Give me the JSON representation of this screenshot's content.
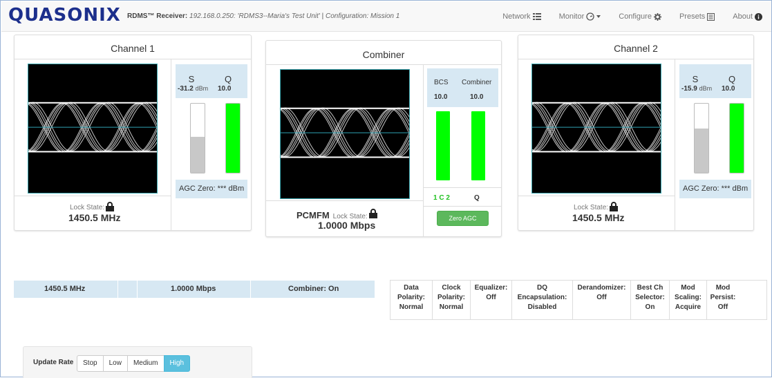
{
  "brand": "QUASONIX",
  "header": {
    "product": "RDMS™ Receiver:",
    "unit": "192.168.0.250: 'RDMS3--Maria's Test Unit'",
    "separator": "|",
    "config": "Configuration: Mission 1"
  },
  "nav": [
    {
      "label": "Network",
      "icon": "list-icon"
    },
    {
      "label": "Monitor",
      "icon": "gauge-icon"
    },
    {
      "label": "Configure",
      "icon": "gear-icon"
    },
    {
      "label": "Presets",
      "icon": "preset-list-icon"
    },
    {
      "label": "About",
      "icon": "info-icon"
    }
  ],
  "channel1": {
    "title": "Channel 1",
    "s_label": "S",
    "q_label": "Q",
    "s_value": "-31.2",
    "s_unit": "dBm",
    "q_value": "10.0",
    "s_level": 0.52,
    "q_level": 1.0,
    "agc": "AGC Zero: *** dBm",
    "lock_label": "Lock State:",
    "freq": "1450.5 MHz"
  },
  "combiner": {
    "title": "Combiner",
    "bcs_label": "BCS",
    "comb_label": "Combiner",
    "bcs_value": "10.0",
    "comb_value": "10.0",
    "bcs_level": 1.0,
    "comb_level": 1.0,
    "bottom_left": "1 C 2",
    "bottom_right": "Q",
    "zero_button": "Zero AGC",
    "mode": "PCMFM",
    "lock_label": "Lock State:",
    "rate": "1.0000 Mbps"
  },
  "channel2": {
    "title": "Channel 2",
    "s_label": "S",
    "q_label": "Q",
    "s_value": "-15.9",
    "s_unit": "dBm",
    "q_value": "10.0",
    "s_level": 0.64,
    "q_level": 1.0,
    "agc": "AGC Zero: *** dBm",
    "lock_label": "Lock State:",
    "freq": "1450.5 MHz"
  },
  "status": {
    "freq": "1450.5 MHz",
    "rate": "1.0000 Mbps",
    "combiner": "Combiner: On"
  },
  "params": [
    {
      "l1": "Data",
      "l2": "Polarity:",
      "l3": "Normal"
    },
    {
      "l1": "Clock",
      "l2": "Polarity:",
      "l3": "Normal"
    },
    {
      "l1": "Equalizer:",
      "l2": "Off",
      "l3": ""
    },
    {
      "l1": "DQ",
      "l2": "Encapsulation:",
      "l3": "Disabled"
    },
    {
      "l1": "Derandomizer:",
      "l2": "Off",
      "l3": ""
    },
    {
      "l1": "Best Ch",
      "l2": "Selector:",
      "l3": "On"
    },
    {
      "l1": "Mod",
      "l2": "Scaling:",
      "l3": "Acquire"
    },
    {
      "l1": "Mod",
      "l2": "Persist:",
      "l3": "Off"
    }
  ],
  "update_rate": {
    "label": "Update Rate",
    "options": [
      "Stop",
      "Low",
      "Medium",
      "High"
    ],
    "selected": "High"
  },
  "colors": {
    "accent": "#5bc0de",
    "gauge_green": "#00ff00",
    "gauge_gray": "#c8c8c8",
    "brand": "#1c2f8c",
    "info_bg": "#d7e8f3",
    "button_green": "#5cb85c"
  }
}
